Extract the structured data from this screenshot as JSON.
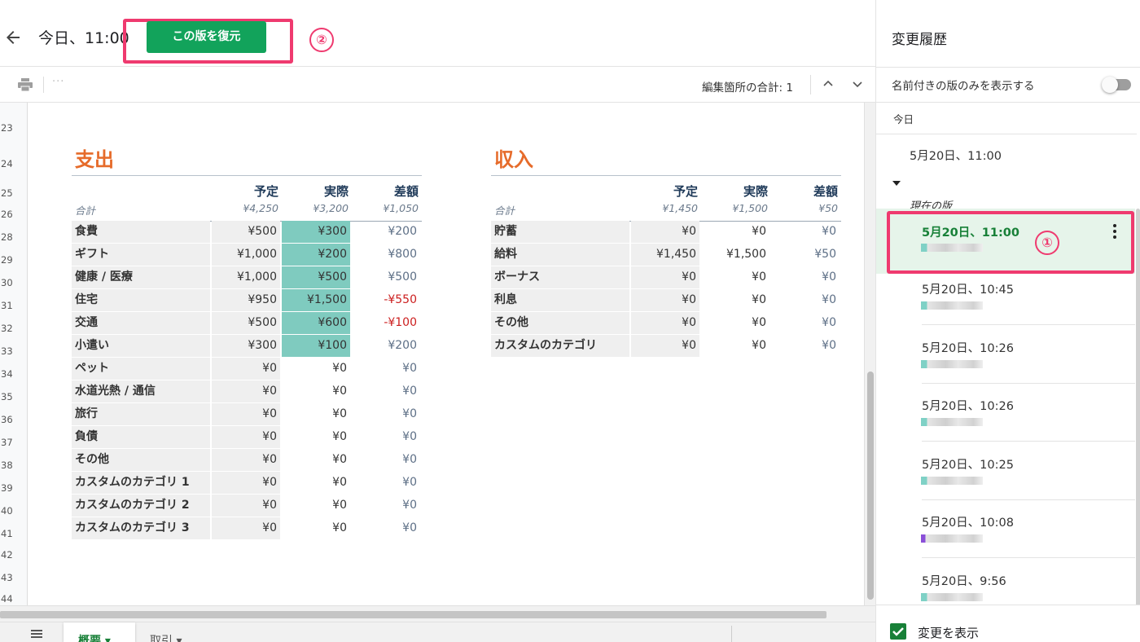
{
  "toolbar": {
    "title": "今日、11:00",
    "restore_label": "この版を復元",
    "marker2": "②",
    "edit_count": "編集箇所の合計: 1",
    "more": "···"
  },
  "row_numbers": [
    "23",
    "24",
    "25",
    "26",
    "28",
    "29",
    "30",
    "31",
    "32",
    "33",
    "34",
    "35",
    "36",
    "37",
    "38",
    "39",
    "40",
    "41",
    "42",
    "43",
    "44"
  ],
  "expenses": {
    "title": "支出",
    "headers": {
      "planned": "予定",
      "actual": "実際",
      "diff": "差額"
    },
    "total_label": "合計",
    "total_planned": "¥4,250",
    "total_actual": "¥3,200",
    "total_diff": "¥1,050",
    "rows": [
      {
        "label": "食費",
        "planned": "¥500",
        "actual": "¥300",
        "diff": "¥200"
      },
      {
        "label": "ギフト",
        "planned": "¥1,000",
        "actual": "¥200",
        "diff": "¥800"
      },
      {
        "label": "健康 / 医療",
        "planned": "¥1,000",
        "actual": "¥500",
        "diff": "¥500"
      },
      {
        "label": "住宅",
        "planned": "¥950",
        "actual": "¥1,500",
        "diff": "-¥550"
      },
      {
        "label": "交通",
        "planned": "¥500",
        "actual": "¥600",
        "diff": "-¥100"
      },
      {
        "label": "小遣い",
        "planned": "¥300",
        "actual": "¥100",
        "diff": "¥200"
      },
      {
        "label": "ペット",
        "planned": "¥0",
        "actual": "¥0",
        "diff": "¥0"
      },
      {
        "label": "水道光熱 / 通信",
        "planned": "¥0",
        "actual": "¥0",
        "diff": "¥0"
      },
      {
        "label": "旅行",
        "planned": "¥0",
        "actual": "¥0",
        "diff": "¥0"
      },
      {
        "label": "負債",
        "planned": "¥0",
        "actual": "¥0",
        "diff": "¥0"
      },
      {
        "label": "その他",
        "planned": "¥0",
        "actual": "¥0",
        "diff": "¥0"
      },
      {
        "label": "カスタムのカテゴリ 1",
        "planned": "¥0",
        "actual": "¥0",
        "diff": "¥0"
      },
      {
        "label": "カスタムのカテゴリ 2",
        "planned": "¥0",
        "actual": "¥0",
        "diff": "¥0"
      },
      {
        "label": "カスタムのカテゴリ 3",
        "planned": "¥0",
        "actual": "¥0",
        "diff": "¥0"
      }
    ]
  },
  "income": {
    "title": "収入",
    "headers": {
      "planned": "予定",
      "actual": "実際",
      "diff": "差額"
    },
    "total_label": "合計",
    "total_planned": "¥1,450",
    "total_actual": "¥1,500",
    "total_diff": "¥50",
    "rows": [
      {
        "label": "貯蓄",
        "planned": "¥0",
        "actual": "¥0",
        "diff": "¥0"
      },
      {
        "label": "給料",
        "planned": "¥1,450",
        "actual": "¥1,500",
        "diff": "¥50"
      },
      {
        "label": "ボーナス",
        "planned": "¥0",
        "actual": "¥0",
        "diff": "¥0"
      },
      {
        "label": "利息",
        "planned": "¥0",
        "actual": "¥0",
        "diff": "¥0"
      },
      {
        "label": "その他",
        "planned": "¥0",
        "actual": "¥0",
        "diff": "¥0"
      },
      {
        "label": "カスタムのカテゴリ",
        "planned": "¥0",
        "actual": "¥0",
        "diff": "¥0"
      }
    ]
  },
  "sheet_tabs": {
    "tab1": "概要 ▾",
    "tab2": "取引 ▾"
  },
  "panel": {
    "title": "変更履歴",
    "named_only": "名前付きの版のみを表示する",
    "today": "今日",
    "current_group": {
      "date": "5月20日、11:00",
      "label": "現在の版"
    },
    "selected": {
      "date": "5月20日、11:00"
    },
    "marker1": "①",
    "versions": [
      {
        "date": "5月20日、10:45"
      },
      {
        "date": "5月20日、10:26"
      },
      {
        "date": "5月20日、10:26"
      },
      {
        "date": "5月20日、10:25"
      },
      {
        "date": "5月20日、10:08"
      },
      {
        "date": "5月20日、9:56"
      }
    ],
    "show_changes": "変更を表示"
  },
  "colors": {
    "accent": "#12a35b",
    "highlight": "#ef3a6f",
    "actual_fill": "#7fcbbf",
    "title_orange": "#e66b2a"
  }
}
